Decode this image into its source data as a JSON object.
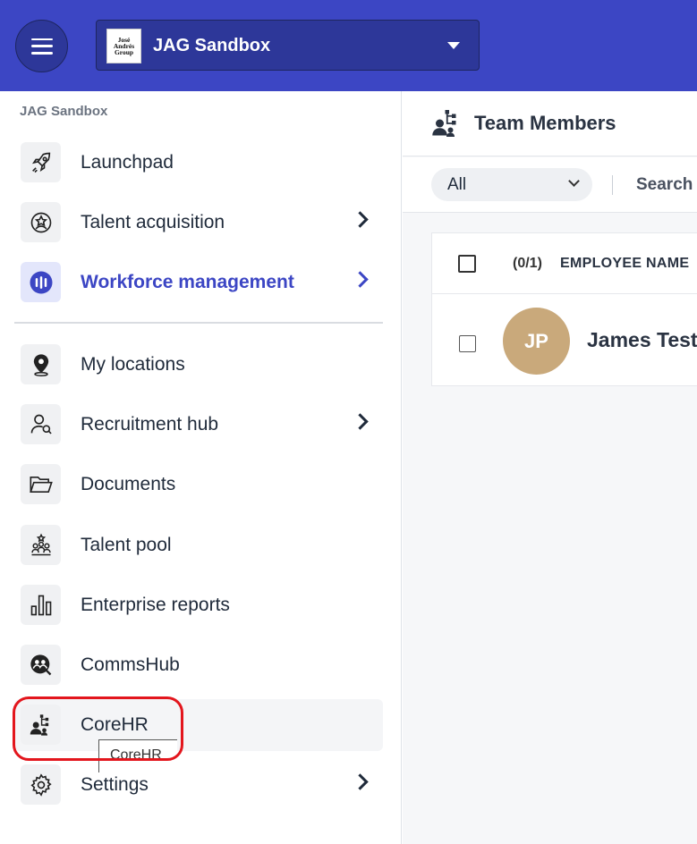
{
  "header": {
    "org_name": "JAG Sandbox",
    "org_logo_text": "José Andrés Group",
    "accent_color": "#3c46c4"
  },
  "sidebar": {
    "breadcrumb": "JAG Sandbox",
    "items": [
      {
        "label": "Launchpad",
        "icon": "rocket-icon"
      },
      {
        "label": "Talent acquisition",
        "icon": "star-badge-icon"
      },
      {
        "label": "Workforce management",
        "icon": "bars-circle-icon"
      },
      {
        "label": "My locations",
        "icon": "location-pin-icon"
      },
      {
        "label": "Recruitment hub",
        "icon": "user-search-icon"
      },
      {
        "label": "Documents",
        "icon": "folder-icon"
      },
      {
        "label": "Talent pool",
        "icon": "group-star-icon"
      },
      {
        "label": "Enterprise reports",
        "icon": "bar-chart-icon"
      },
      {
        "label": "CommsHub",
        "icon": "chat-people-icon"
      },
      {
        "label": "CoreHR",
        "icon": "org-chart-icon"
      },
      {
        "label": "Settings",
        "icon": "gear-icon"
      }
    ],
    "tooltip": "CoreHR"
  },
  "main": {
    "title": "Team Members",
    "filter": {
      "value": "All"
    },
    "search_label": "Search",
    "table": {
      "selection_count": "(0/1)",
      "column_employee": "EMPLOYEE NAME",
      "rows": [
        {
          "initials": "JP",
          "name": "James Test"
        }
      ]
    }
  }
}
